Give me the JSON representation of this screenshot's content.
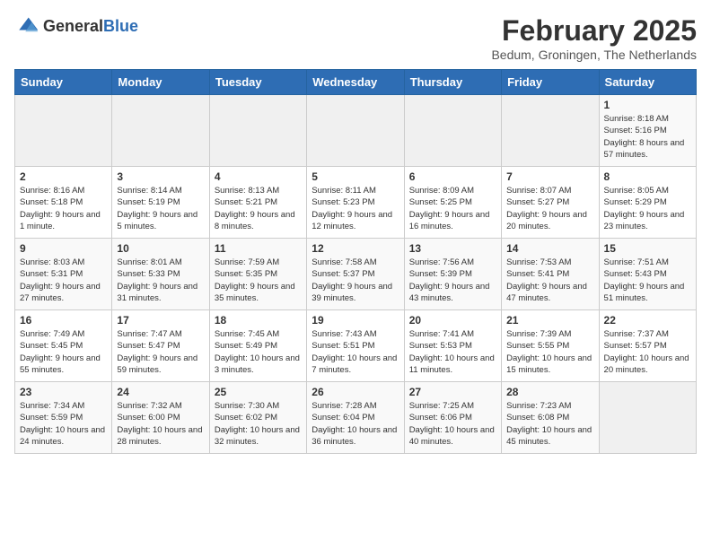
{
  "header": {
    "logo_line1": "General",
    "logo_line2": "Blue",
    "month": "February 2025",
    "location": "Bedum, Groningen, The Netherlands"
  },
  "weekdays": [
    "Sunday",
    "Monday",
    "Tuesday",
    "Wednesday",
    "Thursday",
    "Friday",
    "Saturday"
  ],
  "weeks": [
    [
      {
        "day": "",
        "info": ""
      },
      {
        "day": "",
        "info": ""
      },
      {
        "day": "",
        "info": ""
      },
      {
        "day": "",
        "info": ""
      },
      {
        "day": "",
        "info": ""
      },
      {
        "day": "",
        "info": ""
      },
      {
        "day": "1",
        "info": "Sunrise: 8:18 AM\nSunset: 5:16 PM\nDaylight: 8 hours and 57 minutes."
      }
    ],
    [
      {
        "day": "2",
        "info": "Sunrise: 8:16 AM\nSunset: 5:18 PM\nDaylight: 9 hours and 1 minute."
      },
      {
        "day": "3",
        "info": "Sunrise: 8:14 AM\nSunset: 5:19 PM\nDaylight: 9 hours and 5 minutes."
      },
      {
        "day": "4",
        "info": "Sunrise: 8:13 AM\nSunset: 5:21 PM\nDaylight: 9 hours and 8 minutes."
      },
      {
        "day": "5",
        "info": "Sunrise: 8:11 AM\nSunset: 5:23 PM\nDaylight: 9 hours and 12 minutes."
      },
      {
        "day": "6",
        "info": "Sunrise: 8:09 AM\nSunset: 5:25 PM\nDaylight: 9 hours and 16 minutes."
      },
      {
        "day": "7",
        "info": "Sunrise: 8:07 AM\nSunset: 5:27 PM\nDaylight: 9 hours and 20 minutes."
      },
      {
        "day": "8",
        "info": "Sunrise: 8:05 AM\nSunset: 5:29 PM\nDaylight: 9 hours and 23 minutes."
      }
    ],
    [
      {
        "day": "9",
        "info": "Sunrise: 8:03 AM\nSunset: 5:31 PM\nDaylight: 9 hours and 27 minutes."
      },
      {
        "day": "10",
        "info": "Sunrise: 8:01 AM\nSunset: 5:33 PM\nDaylight: 9 hours and 31 minutes."
      },
      {
        "day": "11",
        "info": "Sunrise: 7:59 AM\nSunset: 5:35 PM\nDaylight: 9 hours and 35 minutes."
      },
      {
        "day": "12",
        "info": "Sunrise: 7:58 AM\nSunset: 5:37 PM\nDaylight: 9 hours and 39 minutes."
      },
      {
        "day": "13",
        "info": "Sunrise: 7:56 AM\nSunset: 5:39 PM\nDaylight: 9 hours and 43 minutes."
      },
      {
        "day": "14",
        "info": "Sunrise: 7:53 AM\nSunset: 5:41 PM\nDaylight: 9 hours and 47 minutes."
      },
      {
        "day": "15",
        "info": "Sunrise: 7:51 AM\nSunset: 5:43 PM\nDaylight: 9 hours and 51 minutes."
      }
    ],
    [
      {
        "day": "16",
        "info": "Sunrise: 7:49 AM\nSunset: 5:45 PM\nDaylight: 9 hours and 55 minutes."
      },
      {
        "day": "17",
        "info": "Sunrise: 7:47 AM\nSunset: 5:47 PM\nDaylight: 9 hours and 59 minutes."
      },
      {
        "day": "18",
        "info": "Sunrise: 7:45 AM\nSunset: 5:49 PM\nDaylight: 10 hours and 3 minutes."
      },
      {
        "day": "19",
        "info": "Sunrise: 7:43 AM\nSunset: 5:51 PM\nDaylight: 10 hours and 7 minutes."
      },
      {
        "day": "20",
        "info": "Sunrise: 7:41 AM\nSunset: 5:53 PM\nDaylight: 10 hours and 11 minutes."
      },
      {
        "day": "21",
        "info": "Sunrise: 7:39 AM\nSunset: 5:55 PM\nDaylight: 10 hours and 15 minutes."
      },
      {
        "day": "22",
        "info": "Sunrise: 7:37 AM\nSunset: 5:57 PM\nDaylight: 10 hours and 20 minutes."
      }
    ],
    [
      {
        "day": "23",
        "info": "Sunrise: 7:34 AM\nSunset: 5:59 PM\nDaylight: 10 hours and 24 minutes."
      },
      {
        "day": "24",
        "info": "Sunrise: 7:32 AM\nSunset: 6:00 PM\nDaylight: 10 hours and 28 minutes."
      },
      {
        "day": "25",
        "info": "Sunrise: 7:30 AM\nSunset: 6:02 PM\nDaylight: 10 hours and 32 minutes."
      },
      {
        "day": "26",
        "info": "Sunrise: 7:28 AM\nSunset: 6:04 PM\nDaylight: 10 hours and 36 minutes."
      },
      {
        "day": "27",
        "info": "Sunrise: 7:25 AM\nSunset: 6:06 PM\nDaylight: 10 hours and 40 minutes."
      },
      {
        "day": "28",
        "info": "Sunrise: 7:23 AM\nSunset: 6:08 PM\nDaylight: 10 hours and 45 minutes."
      },
      {
        "day": "",
        "info": ""
      }
    ]
  ]
}
